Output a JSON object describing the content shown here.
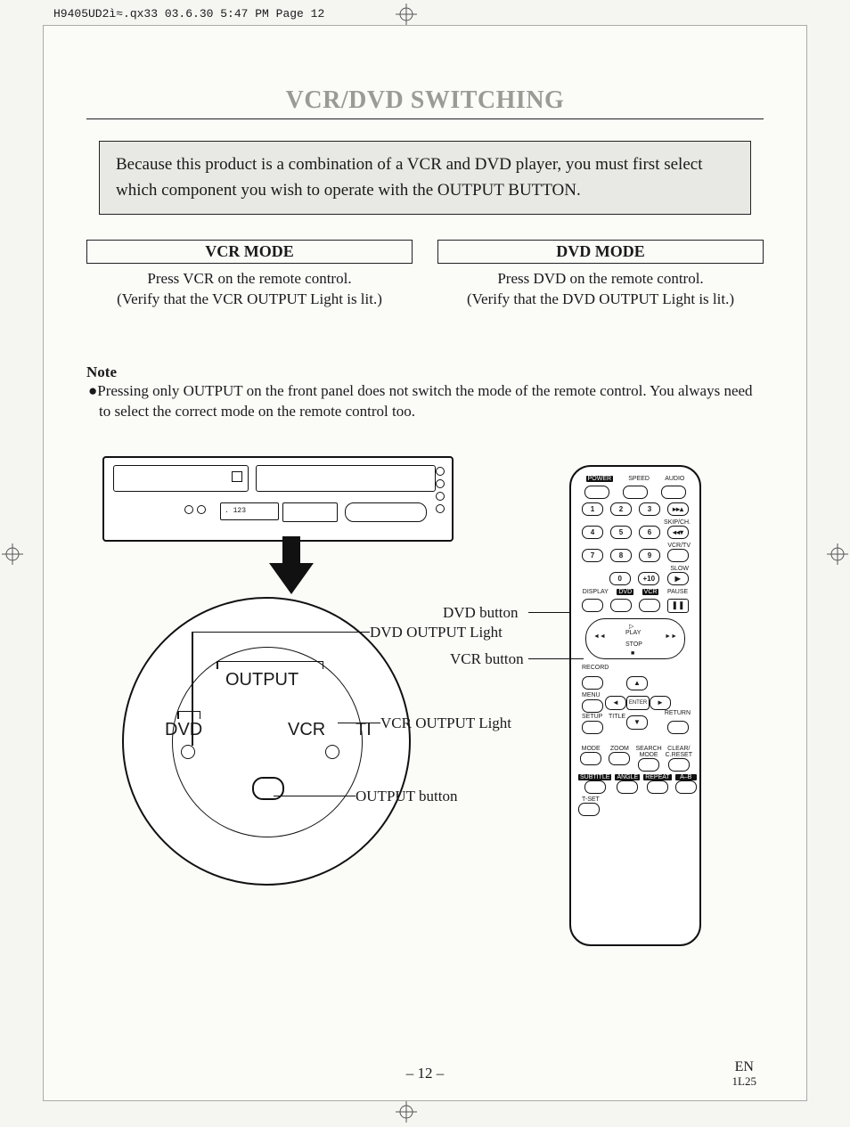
{
  "print_header": "H9405UD2ì≈.qx33  03.6.30 5:47 PM  Page 12",
  "title": "VCR/DVD SWITCHING",
  "intro": "Because this product is a combination of a VCR and DVD player, you must first select which component you wish to operate with the OUTPUT BUTTON.",
  "modes": {
    "vcr": {
      "head": "VCR MODE",
      "line1": "Press VCR on the remote control.",
      "line2": "(Verify that the VCR OUTPUT Light is lit.)"
    },
    "dvd": {
      "head": "DVD MODE",
      "line1": "Press DVD on the remote control.",
      "line2": "(Verify that the DVD OUTPUT Light is lit.)"
    }
  },
  "note_head": "Note",
  "note_body": "●Pressing only OUTPUT on the front panel does not switch the mode of the remote control. You always need to select the correct mode on the remote control too.",
  "diagram": {
    "unit_display": ". 123",
    "magnifier": {
      "output": "OUTPUT",
      "dvd": "DVD",
      "vcr": "VCR",
      "ti": "TI"
    },
    "callouts": {
      "dvd_button": "DVD button",
      "dvd_light": "DVD OUTPUT Light",
      "vcr_button": "VCR button",
      "vcr_light": "VCR OUTPUT Light",
      "output_button": "OUTPUT button"
    }
  },
  "remote": {
    "row1": [
      "POWER",
      "SPEED",
      "AUDIO"
    ],
    "keypad": [
      [
        "1",
        "2",
        "3"
      ],
      [
        "4",
        "5",
        "6"
      ],
      [
        "7",
        "8",
        "9"
      ],
      [
        "",
        "0",
        "+10"
      ]
    ],
    "side_labels": {
      "skipch": "SKIP/CH.",
      "vcrtv": "VCR/TV",
      "slow": "SLOW"
    },
    "mid_row": [
      "DISPLAY",
      "DVD",
      "VCR",
      "PAUSE"
    ],
    "transport": {
      "play": "PLAY",
      "stop": "STOP",
      "rew": "◄◄",
      "ff": "►►",
      "play_icon": "▷",
      "stop_icon": "■"
    },
    "record": "RECORD",
    "menu": "MENU",
    "enter": "ENTER",
    "setup": "SETUP",
    "title": "TITLE",
    "return": "RETURN",
    "row_bottom1": [
      "MODE",
      "ZOOM",
      "SEARCH\nMODE",
      "CLEAR/\nC.RESET"
    ],
    "row_bottom2": [
      "SUBTITLE",
      "ANGLE",
      "REPEAT",
      "A–B"
    ],
    "tset": "T-SET",
    "arrows": {
      "up": "▲",
      "down": "▼",
      "left": "◄",
      "right": "►"
    },
    "pause_icon": "❚❚"
  },
  "footer_page": "– 12 –",
  "footer_right1": "EN",
  "footer_right2": "1L25"
}
